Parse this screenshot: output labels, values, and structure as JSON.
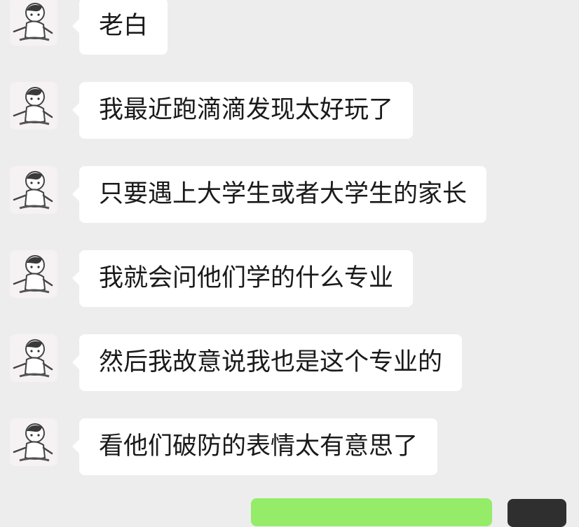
{
  "conversation": {
    "messages": [
      {
        "sender": "other",
        "avatar_icon": "cartoon-boy-avatar-icon",
        "text": "老白"
      },
      {
        "sender": "other",
        "avatar_icon": "cartoon-boy-avatar-icon",
        "text": "我最近跑滴滴发现太好玩了"
      },
      {
        "sender": "other",
        "avatar_icon": "cartoon-boy-avatar-icon",
        "text": "只要遇上大学生或者大学生的家长"
      },
      {
        "sender": "other",
        "avatar_icon": "cartoon-boy-avatar-icon",
        "text": "我就会问他们学的什么专业"
      },
      {
        "sender": "other",
        "avatar_icon": "cartoon-boy-avatar-icon",
        "text": "然后我故意说我也是这个专业的"
      },
      {
        "sender": "other",
        "avatar_icon": "cartoon-boy-avatar-icon",
        "text": "看他们破防的表情太有意思了"
      }
    ]
  },
  "colors": {
    "background": "#ededed",
    "incoming_bubble": "#ffffff",
    "outgoing_bubble": "#95ec69",
    "text": "#1a1a1a"
  }
}
